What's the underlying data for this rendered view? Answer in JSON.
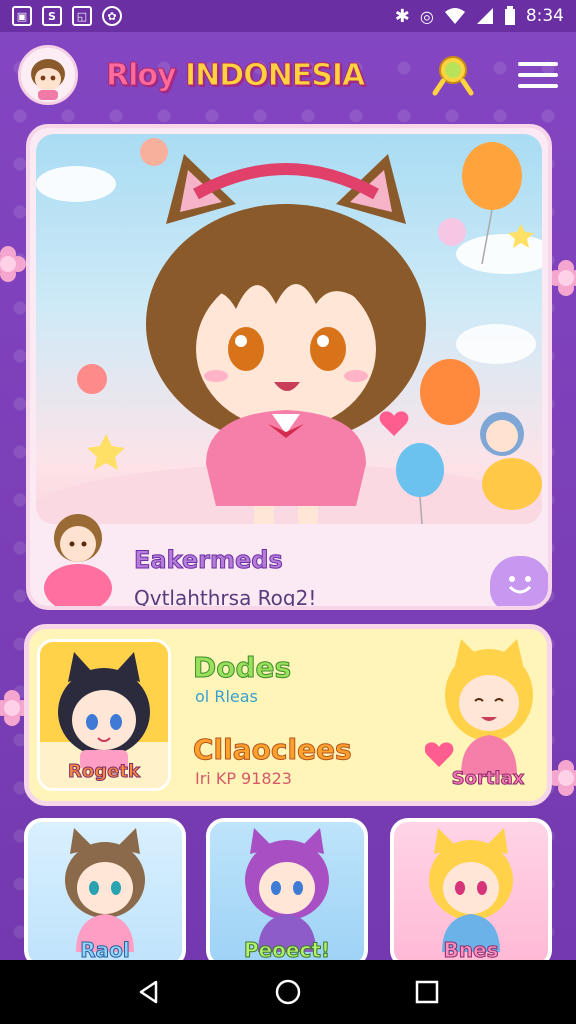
{
  "status_bar": {
    "time": "8:34",
    "left_icons": [
      "notification-icon",
      "shield-icon",
      "image-icon",
      "settings-icon"
    ],
    "right_icons": [
      "bluetooth-icon",
      "vibrate-icon",
      "wifi-icon",
      "signal-icon",
      "battery-icon"
    ]
  },
  "app_bar": {
    "title_part1": "Rloy",
    "title_part2": "INDONESIA"
  },
  "hero": {
    "title": "Eakermeds",
    "subtitle": "Qvtlahthrsa Rog2!"
  },
  "panel": {
    "left_label": "Rogetk",
    "cat1_title": "Dodes",
    "cat1_sub": "ol Rleas",
    "cat2_title": "Cllaoclees",
    "cat2_sub": "Iri KP 91823",
    "right_label": "Sortlax"
  },
  "cards": [
    {
      "label": "Raol"
    },
    {
      "label": "Peoect!"
    },
    {
      "label": "Bnes"
    }
  ],
  "colors": {
    "background": "#7a3fb4",
    "title_pink": "#ff6b9d",
    "title_yellow": "#ffd23f",
    "panel_yellow": "#fff5b8"
  }
}
